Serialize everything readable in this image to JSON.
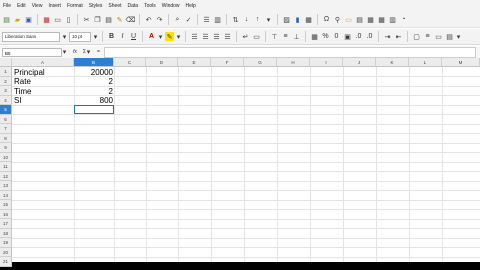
{
  "menu": [
    "File",
    "Edit",
    "View",
    "Insert",
    "Format",
    "Styles",
    "Sheet",
    "Data",
    "Tools",
    "Window",
    "Help"
  ],
  "toolbar": {
    "font_name": "Liberation Sans",
    "font_size": "10 pt",
    "bold": "B",
    "italic": "I",
    "underline": "U"
  },
  "formula_bar": {
    "cell_ref": "B5",
    "fx": "fx",
    "sum": "Σ",
    "equals": "="
  },
  "columns": [
    "A",
    "B",
    "C",
    "D",
    "E",
    "F",
    "G",
    "H",
    "I",
    "J",
    "K",
    "L",
    "M"
  ],
  "rows": [
    "1",
    "2",
    "3",
    "4",
    "5",
    "6",
    "7",
    "8",
    "9",
    "10",
    "11",
    "12",
    "13",
    "14",
    "15",
    "16",
    "17",
    "18",
    "19",
    "20",
    "21",
    "22"
  ],
  "cells": [
    {
      "label": "Principal",
      "value": "20000"
    },
    {
      "label": "Rate",
      "value": "2"
    },
    {
      "label": "Time",
      "value": "2"
    },
    {
      "label": "SI",
      "value": "800"
    }
  ],
  "colors": {
    "selection": "#1a6fd0",
    "header_selected": "#2d7fd4",
    "font_color_swatch": "#d40000",
    "highlight_swatch": "#ffe100"
  }
}
